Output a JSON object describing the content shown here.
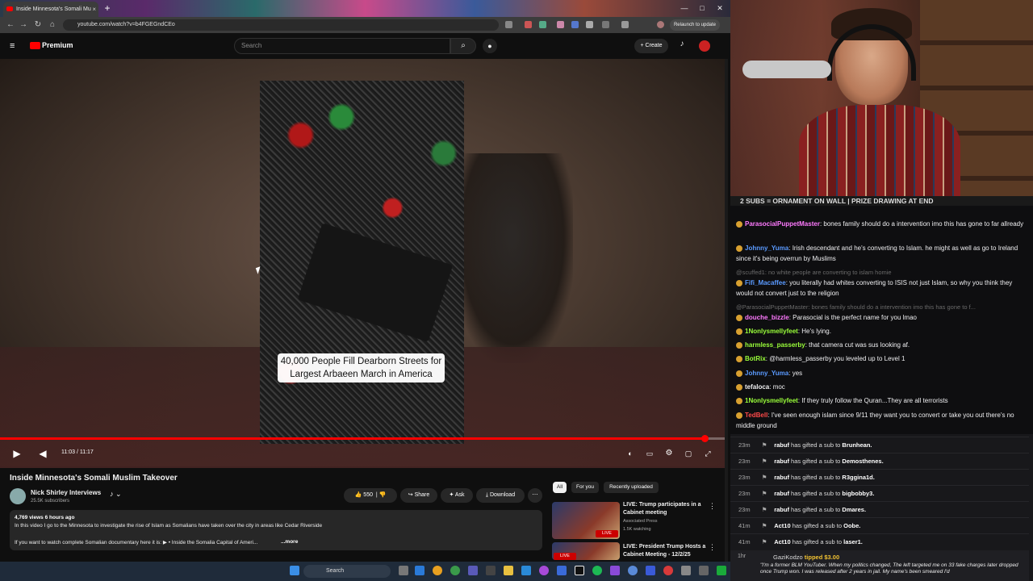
{
  "browser": {
    "tab_title": "Inside Minnesota's Somali Mu",
    "tab_close": "×",
    "new_tab": "+",
    "url": "youtube.com/watch?v=b4FGEGndCEo",
    "relaunch_label": "Relaunch to update",
    "window_buttons": [
      "—",
      "□",
      "✕"
    ]
  },
  "youtube": {
    "logo_text": "Premium",
    "search_placeholder": "Search",
    "create_label": "+ Create",
    "video": {
      "caption": "40,000 People Fill Dearborn Streets for Largest Arbaeen March in America",
      "time": "11:03 / 11:17",
      "progress": 0.97
    },
    "title": "Inside Minnesota's Somali Muslim Takeover",
    "channel": {
      "name": "Nick Shirley Interviews",
      "subscribers": "25.5K subscribers"
    },
    "actions": {
      "likes": "550",
      "share": "Share",
      "ask": "Ask",
      "download": "Download"
    },
    "description": {
      "meta": "4,769 views  6 hours ago",
      "line1": "In this video I go to the Minnesota to investigate the rise of Islam as Somalians have taken over the city in areas like Cedar Riverside",
      "line2": "If you want to watch complete Somalian documentary here it is:  ▶ • Inside the Somalia Capital of Ameri...",
      "more": "...more"
    },
    "chips": [
      "All",
      "For you",
      "Recently uploaded"
    ],
    "recommendations": [
      {
        "title": "LIVE: Trump participates in a Cabinet meeting",
        "channel": "Associated Press",
        "meta": "1.5K watching",
        "badge": "LIVE"
      },
      {
        "title": "LIVE: President Trump Hosts a Cabinet Meeting - 12/2/25",
        "channel": "",
        "meta": "",
        "badge": "LIVE"
      }
    ]
  },
  "stream": {
    "banner": "2 SUBS = ORNAMENT ON WALL | PRIZE DRAWING AT END",
    "chat": [
      {
        "user": "ParasocialPuppetMaster",
        "color": "#ff7aff",
        "text": "bones family should do a intervention imo this has gone to far allready"
      },
      {
        "user": "Johnny_Yuma",
        "color": "#5a9aff",
        "text": "Irish descendant and he's converting to Islam. he might as well as go to Ireland since it's being overrun by Muslims"
      },
      {
        "reply": "@scuffed1: no white people are converting to islam homie"
      },
      {
        "user": "Fifi_Macaffee",
        "color": "#5a9aff",
        "text": "you literally had whites converting to ISIS not just Islam, so why you think they would not convert just to the religion"
      },
      {
        "reply": "@ParasocialPuppetMaster: bones family should do a intervention imo this has gone to f..."
      },
      {
        "user": "douche_bizzle",
        "color": "#ff7aff",
        "text": "Parasocial is the perfect name for you lmao"
      },
      {
        "user": "1Nonlysmellyfeet",
        "color": "#9aff3a",
        "text": "He's lying."
      },
      {
        "user": "harmless_passerby",
        "color": "#9aff3a",
        "text": "that camera cut was sus looking af."
      },
      {
        "user": "BotRix",
        "color": "#9aff3a",
        "text": "@harmless_passerby you leveled up to Level 1"
      },
      {
        "user": "Johnny_Yuma",
        "color": "#5a9aff",
        "text": "yes"
      },
      {
        "user": "tefaloca",
        "color": "#efeff1",
        "text": "moc"
      },
      {
        "user": "1Nonlysmellyfeet",
        "color": "#9aff3a",
        "text": "If they truly follow the Quran...They are all terrorists"
      },
      {
        "user": "TedBell",
        "color": "#ff4a4a",
        "text": "I've seen enough islam since 9/11 they want you to convert or take you out there's no middle ground"
      }
    ],
    "events": [
      {
        "time": "23m",
        "user": "rabuf",
        "text": "has gifted a sub to",
        "target": "Brunhean."
      },
      {
        "time": "23m",
        "user": "rabuf",
        "text": "has gifted a sub to",
        "target": "Demosthenes."
      },
      {
        "time": "23m",
        "user": "rabuf",
        "text": "has gifted a sub to",
        "target": "R3ggina1d."
      },
      {
        "time": "23m",
        "user": "rabuf",
        "text": "has gifted a sub to",
        "target": "bigbobby3."
      },
      {
        "time": "23m",
        "user": "rabuf",
        "text": "has gifted a sub to",
        "target": "Dmares."
      },
      {
        "time": "41m",
        "user": "Act10",
        "text": "has gifted a sub to",
        "target": "Oobe."
      },
      {
        "time": "41m",
        "user": "Act10",
        "text": "has gifted a sub to",
        "target": "laser1."
      }
    ],
    "tip": {
      "time": "1hr",
      "user": "GaziKodzo",
      "amount": "tipped $3.00",
      "text": "\"I'm a former BLM YouTuber. When my politics changed, The left targeted me on 33 fake charges later dropped once Trump won. I was released after 2 years in jail. My name's been smeared I'd"
    }
  },
  "taskbar": {
    "search_label": "Search"
  },
  "colors": {
    "accent": "#ff0000",
    "chat_bg": "#0e0e10",
    "yt_bg": "#0f0f0f"
  }
}
